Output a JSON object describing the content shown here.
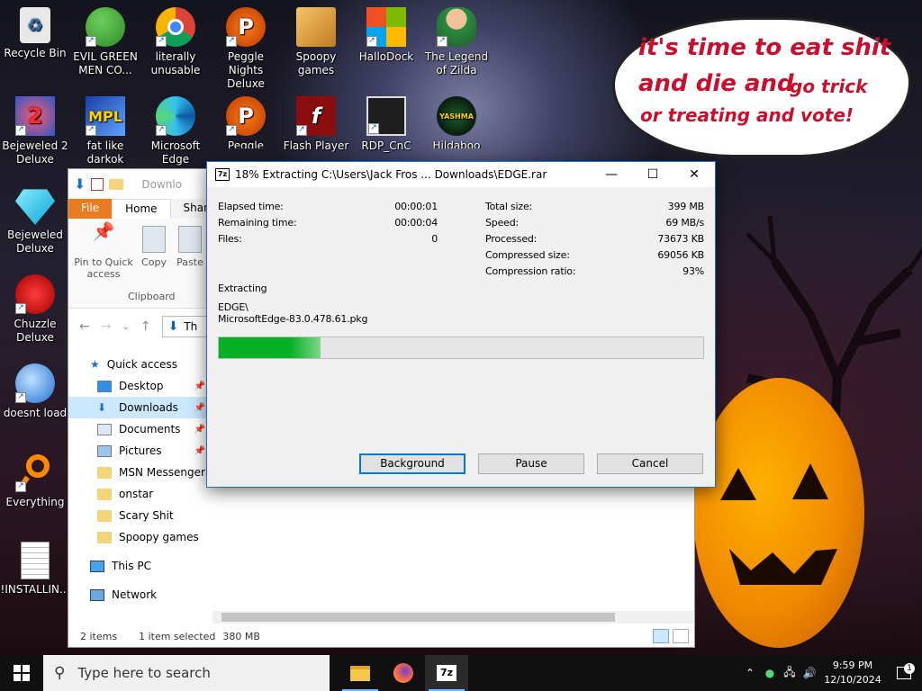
{
  "desktop": {
    "icons": [
      {
        "label": "Recycle Bin",
        "icon": "recycle-bin-icon"
      },
      {
        "label": "EVIL GREEN MEN CO...",
        "icon": "msn-messenger-icon"
      },
      {
        "label": "literally unusable",
        "icon": "chrome-icon"
      },
      {
        "label": "Peggle Nights Deluxe",
        "icon": "peggle-icon"
      },
      {
        "label": "Spoopy games",
        "icon": "folder-icon"
      },
      {
        "label": "HalloDock",
        "icon": "windows-logo-icon"
      },
      {
        "label": "The Legend of Zilda",
        "icon": "zelda-icon"
      },
      {
        "label": "Bejeweled 2 Deluxe",
        "icon": "bejeweled2-icon"
      },
      {
        "label": "fat like darkok",
        "icon": "mpl-icon"
      },
      {
        "label": "Microsoft Edge",
        "icon": "edge-icon"
      },
      {
        "label": "Peggle World of Warcraft",
        "icon": "peggle-icon"
      },
      {
        "label": "Flash Player",
        "icon": "flash-icon"
      },
      {
        "label": "RDP_CnC",
        "icon": "rdp-icon"
      },
      {
        "label": "Hildaboo",
        "icon": "yashma-icon"
      },
      {
        "label": "Bejeweled Deluxe",
        "icon": "diamond-icon"
      },
      {
        "label": "Chuzzle Deluxe",
        "icon": "chuzzle-icon"
      },
      {
        "label": "doesnt load",
        "icon": "thunderbird-icon"
      },
      {
        "label": "Everything",
        "icon": "everything-search-icon"
      },
      {
        "label": "!INSTALLIN...",
        "icon": "text-file-icon"
      }
    ],
    "bubble": {
      "line1": "it's time to eat shit",
      "line2a": "and die and",
      "line2b": "go trick",
      "line3": "or treating and vote!"
    },
    "bubble_color": "#c8102e"
  },
  "explorer": {
    "breadcrumb": "Downlo",
    "tabs": {
      "file": "File",
      "home": "Home",
      "share": "Share"
    },
    "ribbon": {
      "pin": "Pin to Quick access",
      "copy": "Copy",
      "paste": "Paste",
      "group": "Clipboard"
    },
    "address": "Th",
    "nav": {
      "quick_access": "Quick access",
      "desktop": "Desktop",
      "downloads": "Downloads",
      "documents": "Documents",
      "pictures": "Pictures",
      "msn": "MSN Messenger",
      "onstar": "onstar",
      "scary": "Scary Shit",
      "spoopy": "Spoopy games",
      "this_pc": "This PC",
      "network": "Network"
    },
    "status": {
      "items": "2 items",
      "selected": "1 item selected",
      "size": "380 MB"
    }
  },
  "zip": {
    "title": "18% Extracting C:\\Users\\Jack Fros ... Downloads\\EDGE.rar",
    "elapsed_label": "Elapsed time:",
    "elapsed": "00:00:01",
    "remaining_label": "Remaining time:",
    "remaining": "00:00:04",
    "files_label": "Files:",
    "files": "0",
    "total_label": "Total size:",
    "total": "399 MB",
    "speed_label": "Speed:",
    "speed": "69 MB/s",
    "processed_label": "Processed:",
    "processed": "73673 KB",
    "compressed_label": "Compressed size:",
    "compressed": "69056 KB",
    "ratio_label": "Compression ratio:",
    "ratio": "93%",
    "extracting_label": "Extracting",
    "folder": "EDGE\\",
    "file": "MicrosoftEdge-83.0.478.61.pkg",
    "progress": 0.21,
    "progress_color": "#06b025",
    "buttons": {
      "background": "Background",
      "pause": "Pause",
      "cancel": "Cancel"
    }
  },
  "taskbar": {
    "search_placeholder": "Type here to search",
    "time": "9:59 PM",
    "date": "12/10/2024",
    "notifications": "1"
  }
}
